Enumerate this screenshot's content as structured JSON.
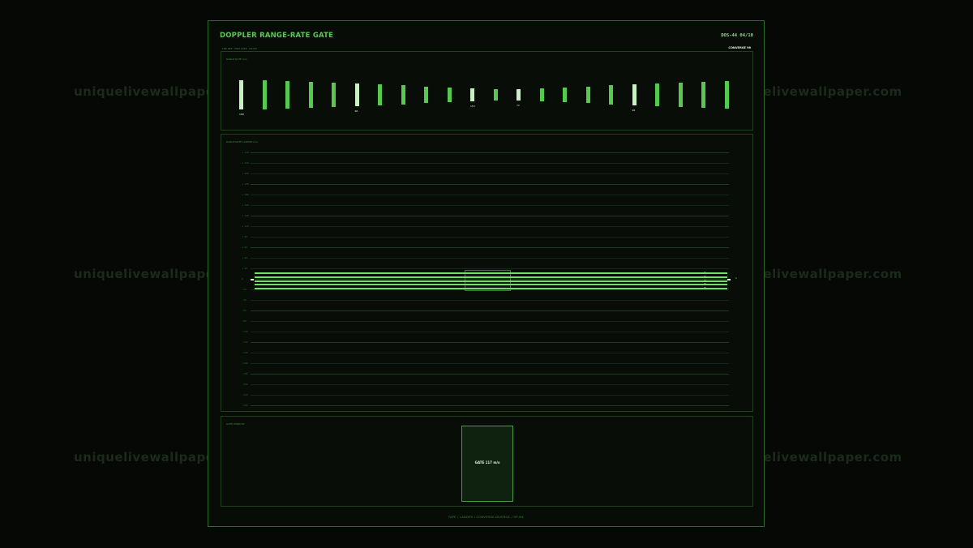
{
  "watermark": {
    "text": "uniquelivewallpaper.com"
  },
  "header": {
    "title": "DOPPLER RANGE-RATE GATE",
    "page_counter": "DOS-44 04/10",
    "subline": "TRK REF · FRM 1083 · HP-M4",
    "mode": "CONVERGE 96"
  },
  "range_rate_panel": {
    "label": "RANGE RATE m/s",
    "bars": [
      {
        "level": 1.0,
        "highlight": true,
        "tag": "188"
      },
      {
        "level": 1.0,
        "highlight": false,
        "tag": ""
      },
      {
        "level": 0.94,
        "highlight": false,
        "tag": ""
      },
      {
        "level": 0.88,
        "highlight": false,
        "tag": ""
      },
      {
        "level": 0.82,
        "highlight": false,
        "tag": ""
      },
      {
        "level": 0.76,
        "highlight": true,
        "tag": "96"
      },
      {
        "level": 0.7,
        "highlight": false,
        "tag": ""
      },
      {
        "level": 0.64,
        "highlight": false,
        "tag": ""
      },
      {
        "level": 0.58,
        "highlight": false,
        "tag": ""
      },
      {
        "level": 0.52,
        "highlight": false,
        "tag": ""
      },
      {
        "level": 0.46,
        "highlight": true,
        "tag": "153"
      },
      {
        "level": 0.4,
        "highlight": false,
        "tag": ""
      },
      {
        "level": 0.4,
        "highlight": true,
        "tag": "72"
      },
      {
        "level": 0.46,
        "highlight": false,
        "tag": ""
      },
      {
        "level": 0.52,
        "highlight": false,
        "tag": ""
      },
      {
        "level": 0.58,
        "highlight": false,
        "tag": ""
      },
      {
        "level": 0.64,
        "highlight": false,
        "tag": ""
      },
      {
        "level": 0.7,
        "highlight": true,
        "tag": "96"
      },
      {
        "level": 0.76,
        "highlight": false,
        "tag": ""
      },
      {
        "level": 0.82,
        "highlight": false,
        "tag": ""
      },
      {
        "level": 0.88,
        "highlight": false,
        "tag": ""
      },
      {
        "level": 0.94,
        "highlight": false,
        "tag": ""
      }
    ]
  },
  "ladder_panel": {
    "label": "RANGE-RATE LADDER m/s",
    "ticks": [
      "+ 240",
      "+ 220",
      "+ 200",
      "+ 180",
      "+ 160",
      "+ 140",
      "+ 120",
      "+ 100",
      "+ 80",
      "+ 60",
      "+ 40",
      "+ 20",
      "0",
      "- 20",
      "- 40",
      "- 60",
      "- 80",
      "- 100",
      "- 120",
      "- 140",
      "- 160",
      "- 180",
      "- 200",
      "- 220",
      "- 240"
    ],
    "traces": [
      "T1",
      "T2",
      "T3",
      "T4",
      "T5"
    ],
    "end_marker": "0"
  },
  "gate_panel": {
    "label": "GATE WINDOW",
    "gate_label": "GATE 117 m/s"
  },
  "footer": {
    "text": "TAPE / LADDER / CONVERGE-DIVERGE / HP-M4"
  },
  "colors": {
    "accent": "#5fcf5a",
    "highlight": "#dff5dc",
    "background": "#050805"
  }
}
